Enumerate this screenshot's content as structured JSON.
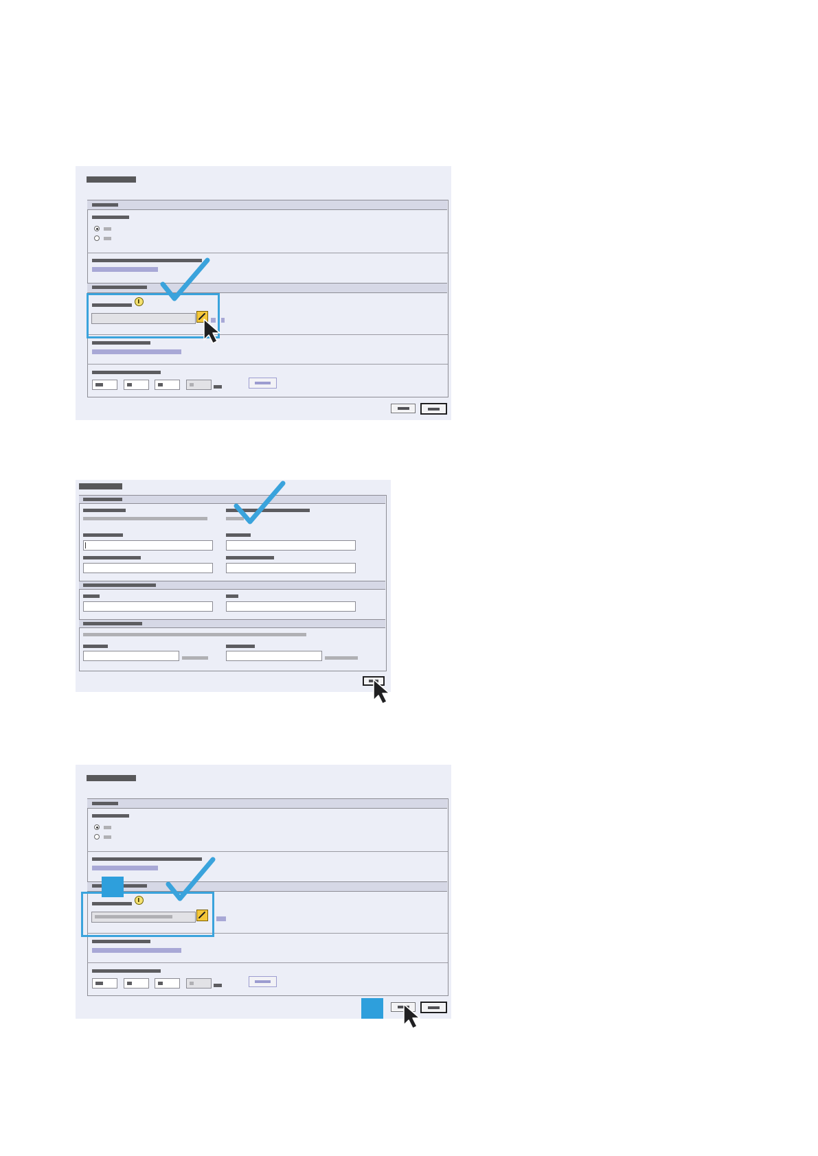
{
  "icons": {
    "checkmark": "checkmark-icon",
    "cursor": "mouse-pointer-icon",
    "pencil": "pencil-edit-icon",
    "info": "info-icon",
    "callout": "step-callout-square"
  },
  "colors": {
    "panel_background": "#eceef7",
    "highlight": "#3aa3dc",
    "callout": "#2e9fdc",
    "link": "#a8a8d6",
    "edit_icon": "#f4c73a"
  },
  "panels": [
    {
      "id": "step-1",
      "radio_selected": "first",
      "edit_field": "empty",
      "highlight": "edit-field"
    },
    {
      "id": "step-2",
      "highlight": "top-right-field",
      "action": "ok-button"
    },
    {
      "id": "step-3",
      "radio_selected": "first",
      "edit_field": "filled",
      "highlight": "edit-field",
      "action": "first-footer-button"
    }
  ]
}
